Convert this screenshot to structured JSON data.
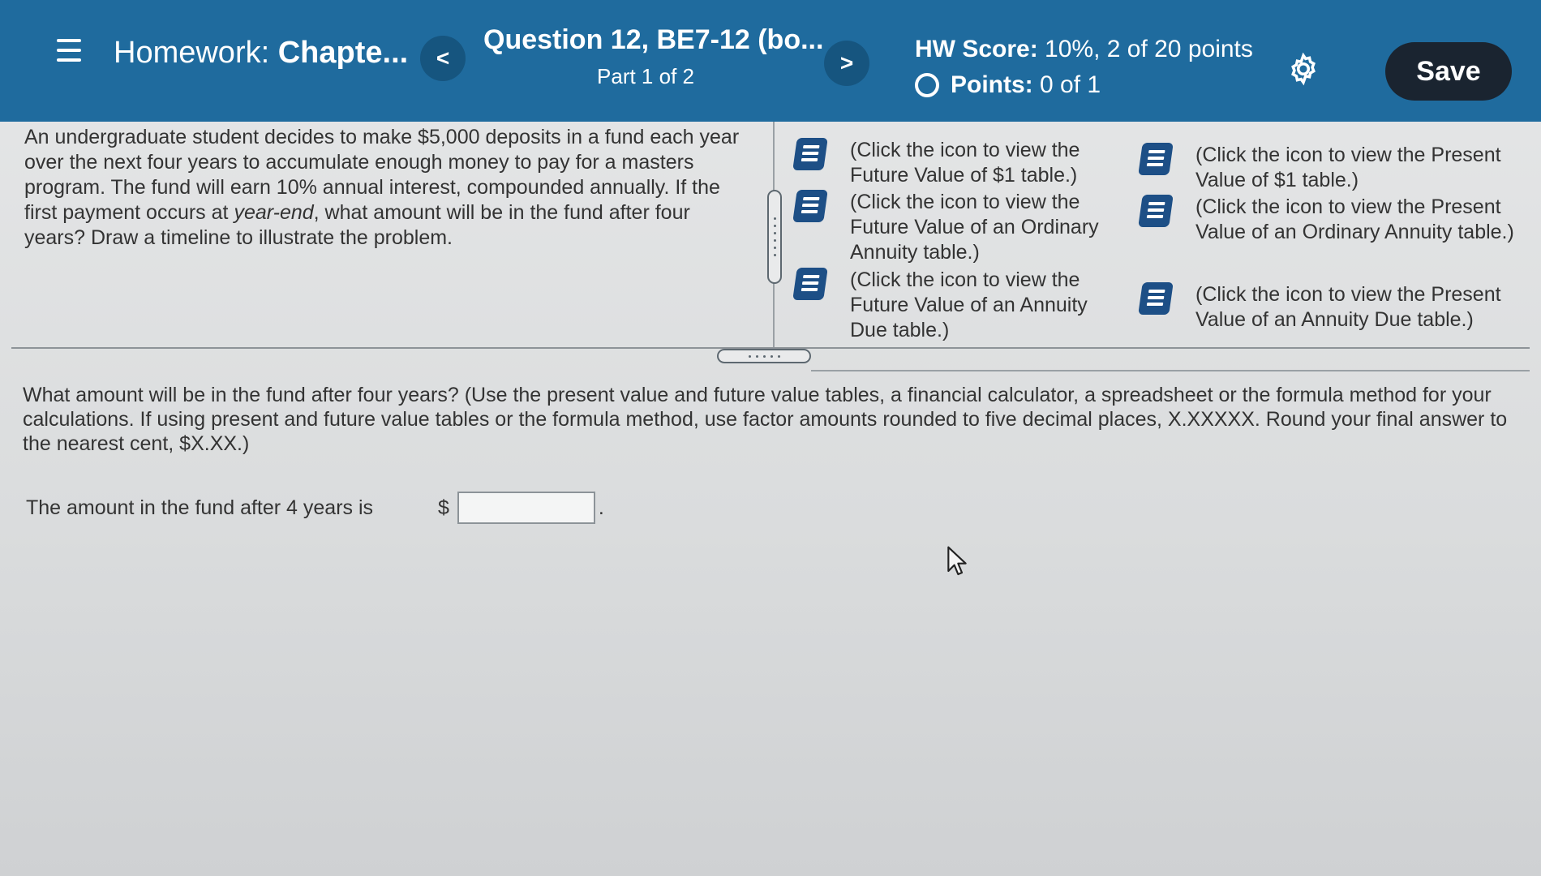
{
  "header": {
    "title_prefix": "Homework:",
    "title_main": "Chapte...",
    "prev_label": "<",
    "next_label": ">",
    "question_title": "Question 12, BE7-12 (bo...",
    "question_part": "Part 1 of 2",
    "hw_score_label": "HW Score:",
    "hw_score_value": "10%, 2 of 20 points",
    "points_label": "Points:",
    "points_value": "0 of 1",
    "save_label": "Save"
  },
  "problem": {
    "text_before": "An undergraduate student decides to make $5,000 deposits in a fund each year over the next four years to accumulate enough money to pay for a masters program. The fund will earn 10% annual interest, compounded annually. If the first payment occurs at ",
    "text_italic": "year-end",
    "text_after": ", what amount will be in the fund after four years? Draw a timeline to illustrate the problem."
  },
  "tables": {
    "fv_single": "(Click the icon to view the Future Value of $1 table.)",
    "fv_ordinary": "(Click the icon to view the Future Value of an Ordinary Annuity table.)",
    "fv_due": "(Click the icon to view the Future Value of an Annuity Due table.)",
    "pv_single": "(Click the icon to view the Present Value of $1 table.)",
    "pv_ordinary": "(Click the icon to view the Present Value of an Ordinary Annuity table.)",
    "pv_due": "(Click the icon to view the Present Value of an Annuity Due table.)"
  },
  "question": {
    "text": "What amount will be in the fund after four years? (Use the present value and future value tables, a financial calculator, a spreadsheet or the formula method for your calculations. If using present and future value tables or the formula method, use factor amounts rounded to five decimal places, X.XXXXX. Round your final answer to the nearest cent, $X.XX.)"
  },
  "answer": {
    "label": "The amount in the fund after 4 years is",
    "currency": "$",
    "value": "",
    "suffix": "."
  },
  "colors": {
    "header_bg": "#1f6b9e",
    "save_bg": "#1a2430",
    "book_icon": "#1d4f86"
  },
  "icons": [
    "menu-icon",
    "chevron-left-icon",
    "chevron-right-icon",
    "circle-icon",
    "gear-icon",
    "book-icon",
    "cursor-icon"
  ]
}
